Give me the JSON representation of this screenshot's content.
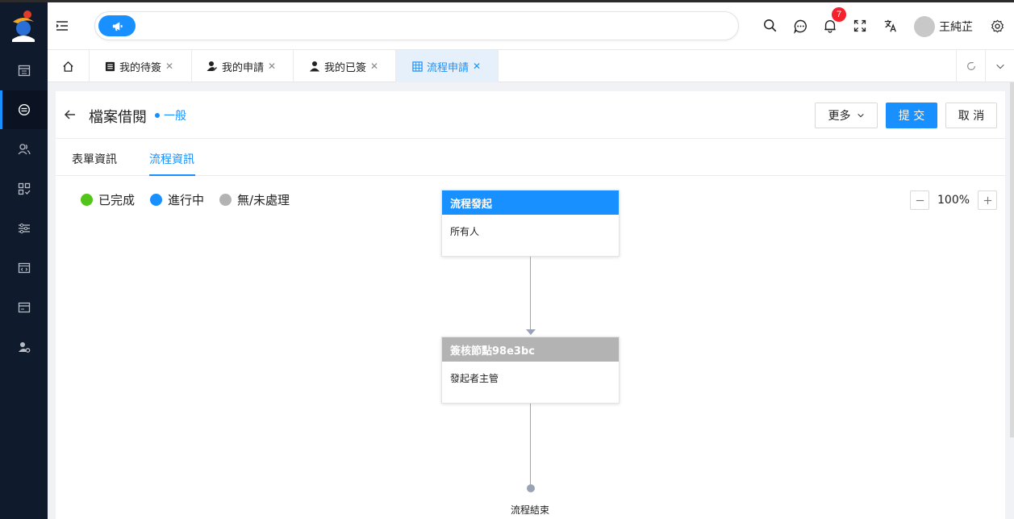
{
  "header": {
    "username": "王純芷",
    "notification_count": "7"
  },
  "sidebar": {
    "items": [
      {
        "icon": "calendar-icon"
      },
      {
        "icon": "flow-icon",
        "active": true
      },
      {
        "icon": "users-icon"
      },
      {
        "icon": "apps-icon"
      },
      {
        "icon": "list-settings-icon"
      },
      {
        "icon": "code-window-icon"
      },
      {
        "icon": "card-icon"
      },
      {
        "icon": "user-gear-icon"
      }
    ]
  },
  "tabs": [
    {
      "label": "我的待簽",
      "icon": "todo-icon",
      "closable": true
    },
    {
      "label": "我的申請",
      "icon": "user-edit-icon",
      "closable": true
    },
    {
      "label": "我的已簽",
      "icon": "user-icon",
      "closable": true
    },
    {
      "label": "流程申請",
      "icon": "table-icon",
      "closable": true,
      "active": true
    }
  ],
  "page": {
    "title": "檔案借閱",
    "level": "一般",
    "buttons": {
      "more": "更多",
      "submit": "提 交",
      "cancel": "取 消"
    },
    "subtabs": [
      {
        "label": "表單資訊"
      },
      {
        "label": "流程資訊",
        "active": true
      }
    ]
  },
  "legend": [
    {
      "label": "已完成",
      "color": "#52c41a"
    },
    {
      "label": "進行中",
      "color": "#1890ff"
    },
    {
      "label": "無/未處理",
      "color": "#b3b3b3"
    }
  ],
  "zoom": {
    "value": "100%"
  },
  "flow": {
    "nodes": [
      {
        "title": "流程發起",
        "body": "所有人",
        "color": "#1890ff"
      },
      {
        "title": "簽核節點98e3bc",
        "body": "發起者主管",
        "color": "#b3b3b3"
      }
    ],
    "end_label": "流程結束"
  },
  "colors": {
    "accent": "#1890ff",
    "sidebar": "#0f1a2c"
  }
}
